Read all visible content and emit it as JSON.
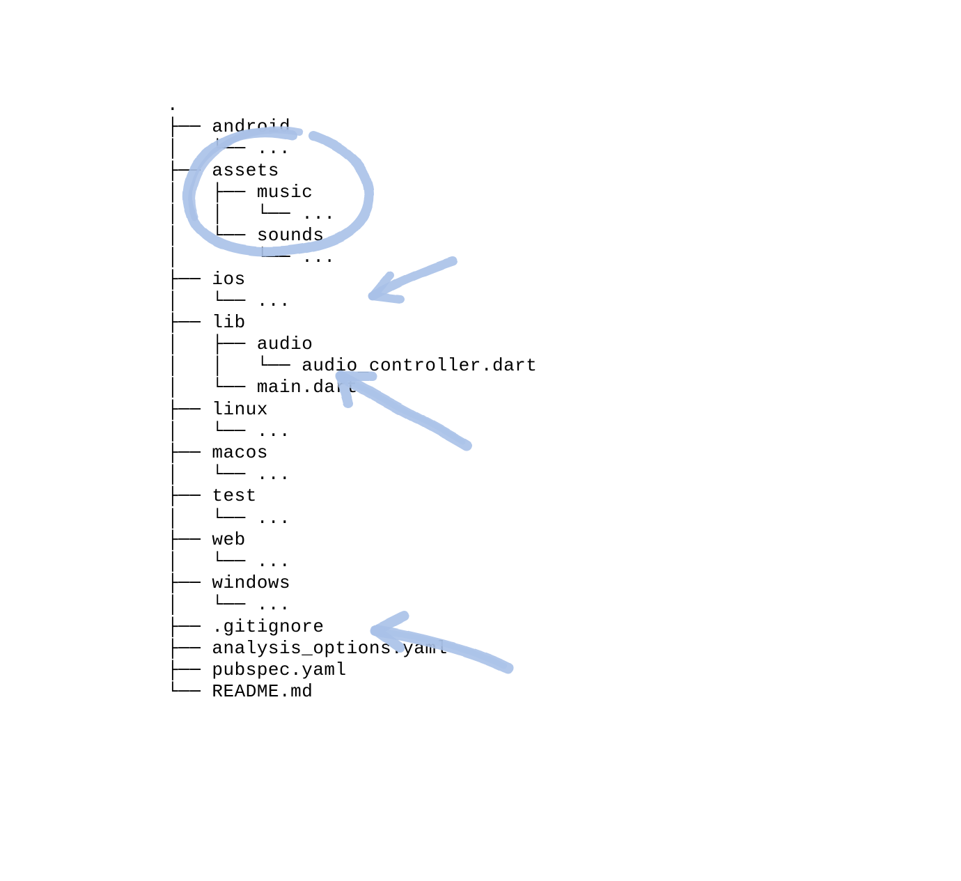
{
  "annotation_color": "#a9c1e8",
  "tree": {
    "root": ".",
    "lines": [
      ".",
      "├── android",
      "│   └── ...",
      "├── assets",
      "│   ├── music",
      "│   │   └── ...",
      "│   └── sounds",
      "│       └── ...",
      "├── ios",
      "│   └── ...",
      "├── lib",
      "│   ├── audio",
      "│   │   └── audio_controller.dart",
      "│   └── main.dart",
      "├── linux",
      "│   └── ...",
      "├── macos",
      "│   └── ...",
      "├── test",
      "│   └── ...",
      "├── web",
      "│   └── ...",
      "├── windows",
      "│   └── ...",
      "├── .gitignore",
      "├── analysis_options.yaml",
      "├── pubspec.yaml",
      "└── README.md"
    ]
  },
  "annotations": [
    {
      "kind": "circle",
      "targets": [
        "assets",
        "music",
        "sounds"
      ]
    },
    {
      "kind": "arrow",
      "target": "lib/audio"
    },
    {
      "kind": "arrow",
      "target": "main.dart"
    },
    {
      "kind": "arrow",
      "target": "pubspec.yaml"
    }
  ]
}
